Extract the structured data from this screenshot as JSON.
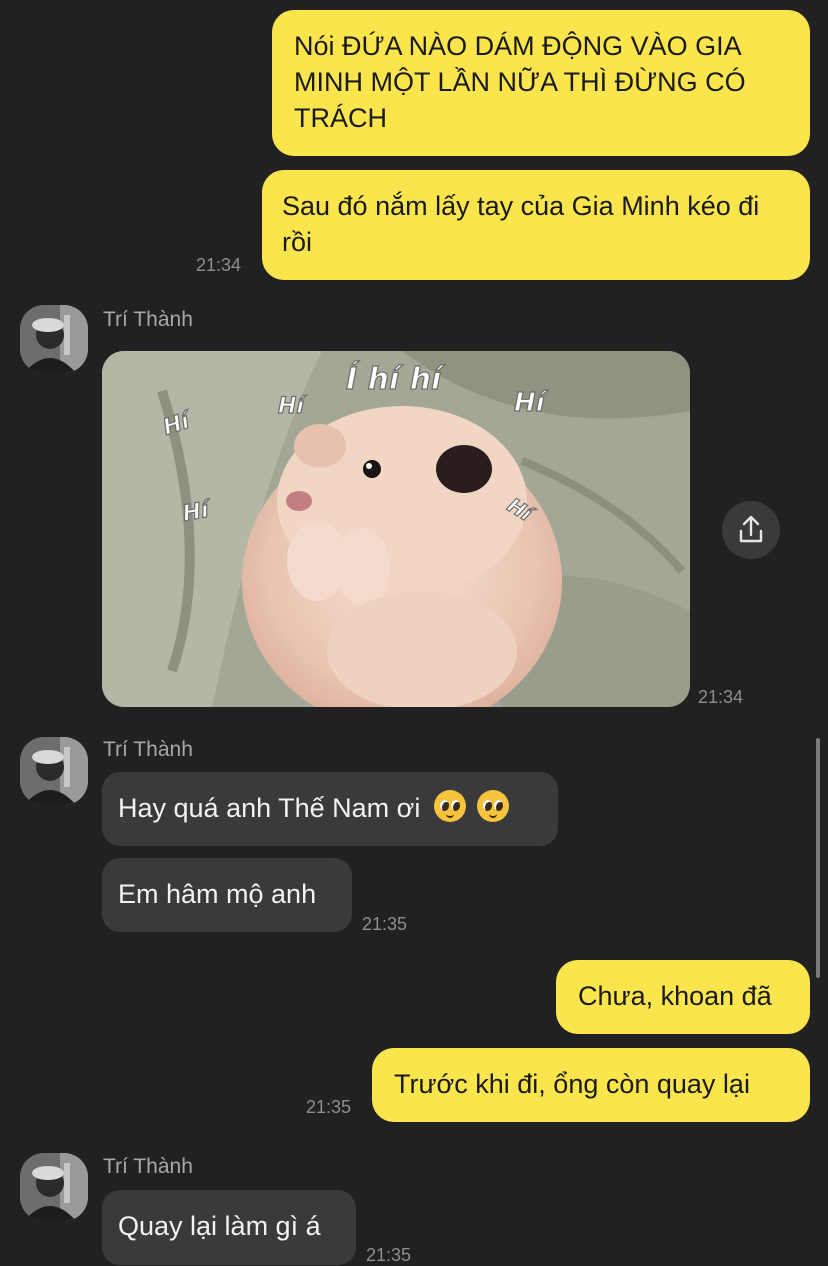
{
  "messages": {
    "out1": {
      "text": "Nói ĐỨA NÀO DÁM ĐỘNG VÀO GIA MINH MỘT LẦN NỮA THÌ ĐỪNG CÓ TRÁCH"
    },
    "out2": {
      "text": "Sau đó nắm lấy tay của Gia Minh kéo đi rồi",
      "time": "21:34"
    },
    "in_group1": {
      "sender": "Trí Thành",
      "time": "21:34"
    },
    "sticker": {
      "words": [
        "Í hí hí",
        "Hí",
        "Hí",
        "Hí",
        "Hí",
        "Hí"
      ]
    },
    "in_group2": {
      "sender": "Trí Thành",
      "msg1": "Hay quá anh Thế Nam ơi",
      "msg2": "Em hâm mộ anh",
      "time": "21:35"
    },
    "out3": {
      "text": "Chưa, khoan đã"
    },
    "out4": {
      "text": "Trước khi đi, ổng còn quay lại",
      "time": "21:35"
    },
    "in_group3": {
      "sender": "Trí Thành",
      "msg1": "Quay lại làm gì á",
      "time": "21:35"
    }
  },
  "colors": {
    "background": "#212121",
    "outgoing": "#fae54c",
    "incoming": "#3a3a3c",
    "timestamp": "#8e8e8e"
  },
  "icons": {
    "share": "share-icon",
    "emoji": "pleading-face-emoji"
  }
}
